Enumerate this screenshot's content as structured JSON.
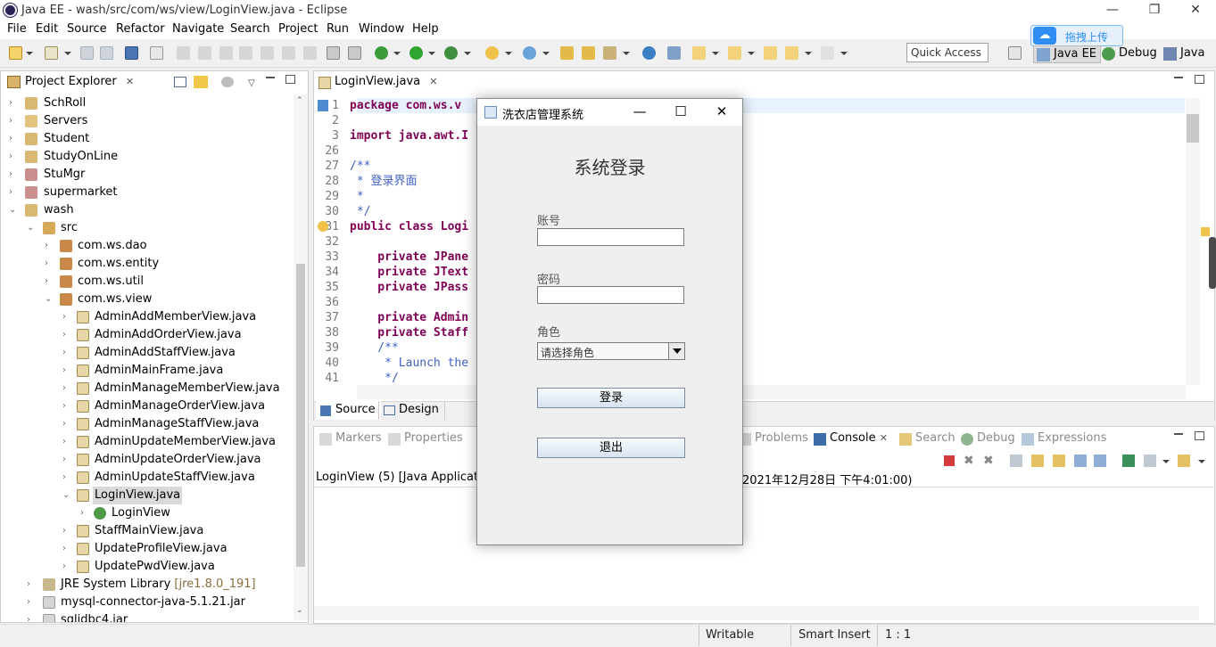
{
  "window": {
    "title": "Java EE - wash/src/com/ws/view/LoginView.java - Eclipse",
    "minimize": "—",
    "restore": "❐",
    "close": "✕"
  },
  "menu": [
    "File",
    "Edit",
    "Source",
    "Refactor",
    "Navigate",
    "Search",
    "Project",
    "Run",
    "Window",
    "Help"
  ],
  "toolbar": {
    "quick_access": "Quick Access",
    "upload_label": "拖拽上传",
    "perspectives": [
      "Java EE",
      "Debug",
      "Java"
    ]
  },
  "explorer": {
    "tab_label": "Project Explorer",
    "tab_close": "✕",
    "items": [
      {
        "label": "SchRoll",
        "decor": ""
      },
      {
        "label": "Servers",
        "decor": ""
      },
      {
        "label": "Student",
        "decor": ""
      },
      {
        "label": "StudyOnLine",
        "decor": ""
      },
      {
        "label": "StuMgr",
        "decor": ""
      },
      {
        "label": "supermarket",
        "decor": ""
      },
      {
        "label": "wash",
        "decor": ""
      },
      {
        "label": "src",
        "decor": ""
      },
      {
        "label": "com.ws.dao",
        "decor": ""
      },
      {
        "label": "com.ws.entity",
        "decor": ""
      },
      {
        "label": "com.ws.util",
        "decor": ""
      },
      {
        "label": "com.ws.view",
        "decor": ""
      },
      {
        "label": "AdminAddMemberView.java",
        "decor": ""
      },
      {
        "label": "AdminAddOrderView.java",
        "decor": ""
      },
      {
        "label": "AdminAddStaffView.java",
        "decor": ""
      },
      {
        "label": "AdminMainFrame.java",
        "decor": ""
      },
      {
        "label": "AdminManageMemberView.java",
        "decor": ""
      },
      {
        "label": "AdminManageOrderView.java",
        "decor": ""
      },
      {
        "label": "AdminManageStaffView.java",
        "decor": ""
      },
      {
        "label": "AdminUpdateMemberView.java",
        "decor": ""
      },
      {
        "label": "AdminUpdateOrderView.java",
        "decor": ""
      },
      {
        "label": "AdminUpdateStaffView.java",
        "decor": ""
      },
      {
        "label": "LoginView.java",
        "decor": ""
      },
      {
        "label": "LoginView",
        "decor": ""
      },
      {
        "label": "StaffMainView.java",
        "decor": ""
      },
      {
        "label": "UpdateProfileView.java",
        "decor": ""
      },
      {
        "label": "UpdatePwdView.java",
        "decor": ""
      },
      {
        "label": "JRE System Library",
        "decor": "[jre1.8.0_191]"
      },
      {
        "label": "mysql-connector-java-5.1.21.jar",
        "decor": ""
      },
      {
        "label": "sqljdbc4.jar",
        "decor": ""
      }
    ]
  },
  "editor": {
    "tab_label": "LoginView.java",
    "tab_close": "✕",
    "lines": [
      {
        "num": "1",
        "text": "package com.ws.v"
      },
      {
        "num": "2",
        "text": ""
      },
      {
        "num": "3",
        "text": "import java.awt.I"
      },
      {
        "num": "26",
        "text": ""
      },
      {
        "num": "27",
        "text": "/**"
      },
      {
        "num": "28",
        "text": " * 登录界面"
      },
      {
        "num": "29",
        "text": " *"
      },
      {
        "num": "30",
        "text": " */"
      },
      {
        "num": "31",
        "text": "public class Logi"
      },
      {
        "num": "32",
        "text": ""
      },
      {
        "num": "33",
        "text": "    private JPane"
      },
      {
        "num": "34",
        "text": "    private JText"
      },
      {
        "num": "35",
        "text": "    private JPass"
      },
      {
        "num": "36",
        "text": ""
      },
      {
        "num": "37",
        "text": "    private Admin"
      },
      {
        "num": "38",
        "text": "    private Staff"
      },
      {
        "num": "39",
        "text": "    /**"
      },
      {
        "num": "40",
        "text": "     * Launch the"
      },
      {
        "num": "41",
        "text": "     */"
      }
    ],
    "source_tab": "Source",
    "design_tab": "Design"
  },
  "bottom": {
    "tabs": [
      "Markers",
      "Properties",
      "Problems",
      "Console",
      "Search",
      "Debug",
      "Expressions"
    ],
    "console_close": "✕",
    "console_header_left": "LoginView (5) [Java Application",
    "console_header_right": "2021年12月28日 下午4:01:00)"
  },
  "status": {
    "writable": "Writable",
    "insert_mode": "Smart Insert",
    "position": "1 : 1"
  },
  "dialog": {
    "title": "洗衣店管理系统",
    "minimize": "—",
    "maximize": "☐",
    "close": "✕",
    "heading": "系统登录",
    "account_label": "账号",
    "account_value": "",
    "password_label": "密码",
    "password_value": "",
    "role_label": "角色",
    "role_selected": "请选择角色",
    "login_button": "登录",
    "exit_button": "退出"
  }
}
